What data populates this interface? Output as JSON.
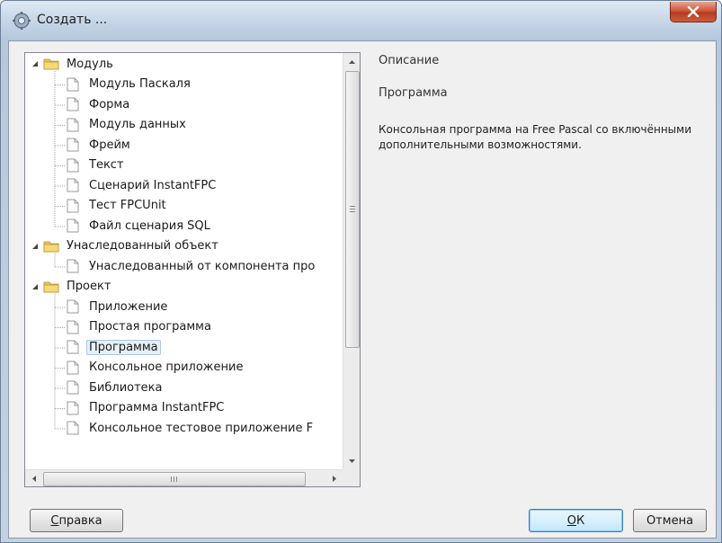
{
  "window": {
    "title": "Создать ..."
  },
  "tree": {
    "groups": [
      {
        "label": "Модуль",
        "items": [
          "Модуль Паскаля",
          "Форма",
          "Модуль данных",
          "Фрейм",
          "Текст",
          "Сценарий InstantFPC",
          "Тест FPCUnit",
          "Файл сценария SQL"
        ]
      },
      {
        "label": "Унаследованный объект",
        "items": [
          "Унаследованный от компонента про"
        ]
      },
      {
        "label": "Проект",
        "items": [
          "Приложение",
          "Простая программа",
          "Программа",
          "Консольное приложение",
          "Библиотека",
          "Программа InstantFPC",
          "Консольное тестовое приложение F"
        ]
      }
    ],
    "selected": "Программа"
  },
  "description": {
    "header": "Описание",
    "name": "Программа",
    "text": "Консольная программа на Free Pascal со включёнными дополнительными возможностями."
  },
  "buttons": {
    "help_first": "С",
    "help_rest": "правка",
    "ok_first": "О",
    "ok_rest": "К",
    "cancel": "Отмена"
  },
  "colors": {
    "folder": "#e9c45a",
    "selection": "#e6f0fb",
    "close_button": "#c9452a"
  }
}
